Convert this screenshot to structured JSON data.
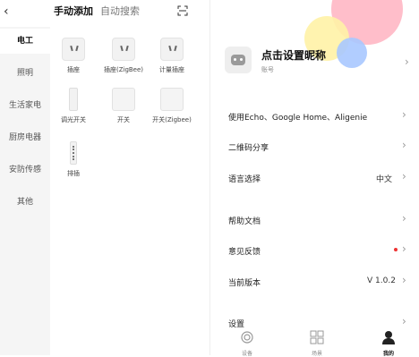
{
  "left": {
    "tabs": {
      "active": "手动添加",
      "inactive": "自动搜索"
    },
    "sidebar": [
      "电工",
      "照明",
      "生活家电",
      "厨房电器",
      "安防传感",
      "其他"
    ],
    "devices": [
      {
        "label": "插座",
        "icon": "socket-icon"
      },
      {
        "label": "插座(ZigBee)",
        "icon": "socket-icon"
      },
      {
        "label": "计量插座",
        "icon": "socket-icon"
      },
      {
        "label": "调光开关",
        "icon": "dimmer-switch-icon"
      },
      {
        "label": "开关",
        "icon": "switch-icon"
      },
      {
        "label": "开关(Zigbee)",
        "icon": "switch-icon"
      },
      {
        "label": "排插",
        "icon": "power-strip-icon"
      }
    ]
  },
  "right": {
    "profile": {
      "nickname": "点击设置昵称",
      "account": "账号"
    },
    "menu": [
      {
        "label": "使用Echo、Google Home、Aligenie",
        "value": ""
      },
      {
        "label": "二维码分享",
        "value": ""
      },
      {
        "label": "语言选择",
        "value": "中文"
      },
      {
        "label": "帮助文档",
        "value": ""
      },
      {
        "label": "意见反馈",
        "value": ""
      },
      {
        "label": "当前版本",
        "value": "V 1.0.2"
      },
      {
        "label": "设置",
        "value": ""
      }
    ],
    "tabbar": [
      {
        "label": "设备",
        "icon": "device-icon",
        "active": false
      },
      {
        "label": "场景",
        "icon": "scene-icon",
        "active": false
      },
      {
        "label": "我的",
        "icon": "me-icon",
        "active": true
      }
    ]
  }
}
